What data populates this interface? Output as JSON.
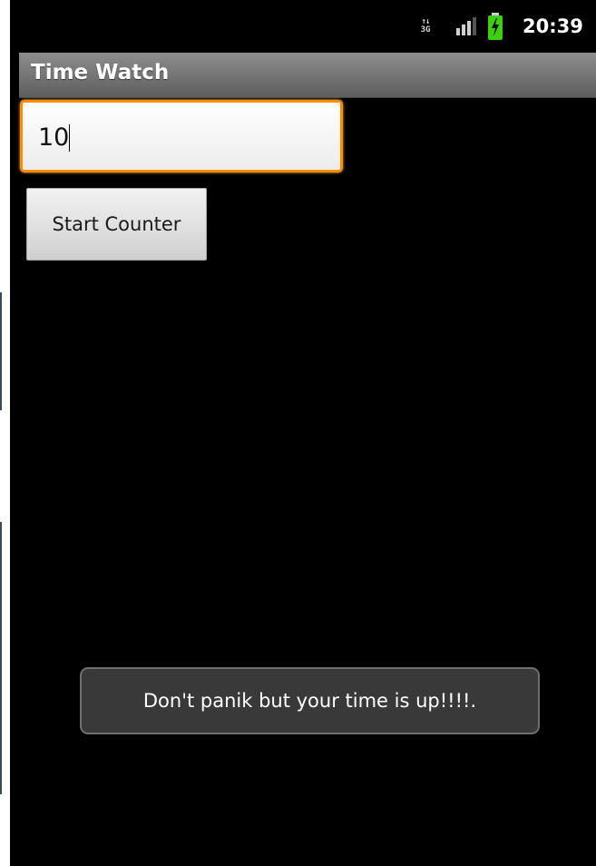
{
  "status_bar": {
    "network_label": "3G",
    "network_arrows": "↑↓",
    "signal_icon": "signal-strength-icon",
    "battery_icon": "battery-charging-icon",
    "time": "20:39",
    "colors": {
      "battery": "#3ccf12",
      "signal_on": "#cfcfcf",
      "signal_off": "#555555"
    }
  },
  "app": {
    "title": "Time Watch"
  },
  "main": {
    "counter_input": {
      "value": "10"
    },
    "start_button_label": "Start Counter"
  },
  "toast": {
    "message": "Don't panik but your time is up!!!!."
  },
  "colors": {
    "input_focus_border": "#ff8c00",
    "title_bar": "#747474",
    "background": "#000000"
  }
}
